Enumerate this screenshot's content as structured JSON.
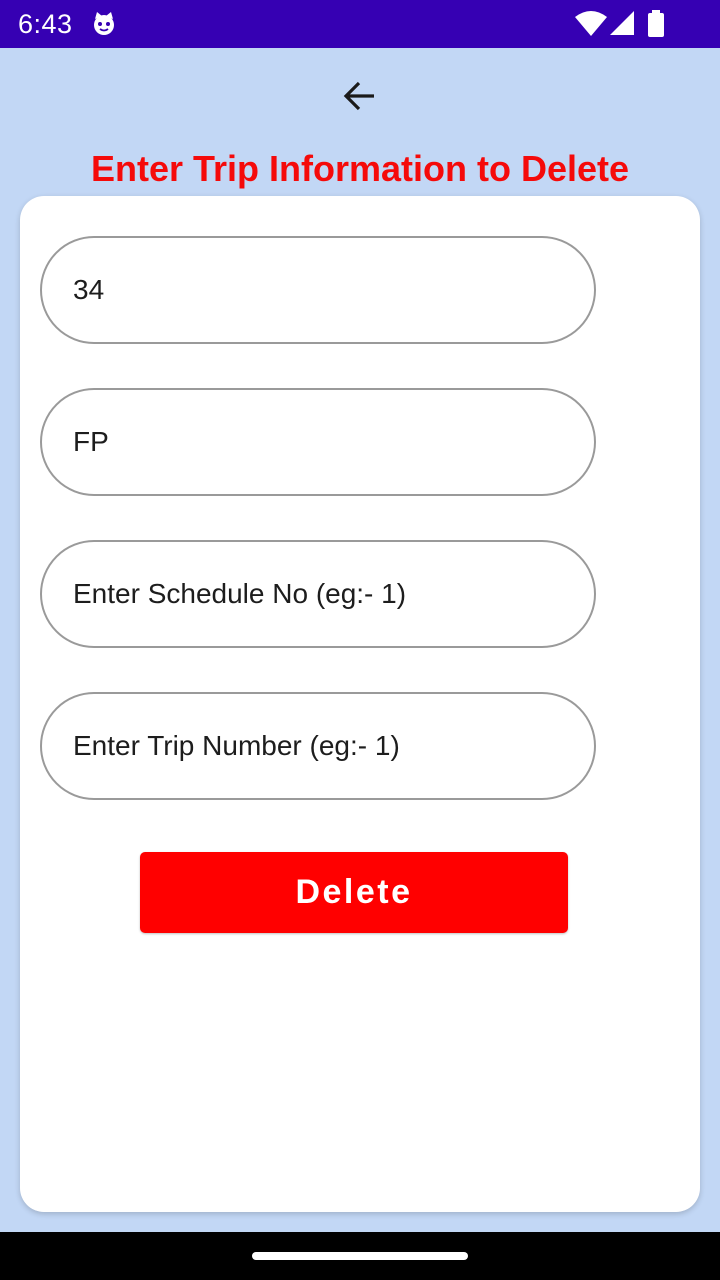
{
  "status_bar": {
    "time": "6:43",
    "icons": [
      "cat-notification-icon",
      "wifi-icon",
      "cellular-signal-icon",
      "battery-icon"
    ]
  },
  "header": {
    "back_icon": "arrow-left-icon",
    "title": "Enter Trip Information to Delete"
  },
  "form": {
    "fields": [
      {
        "value": "34",
        "placeholder": ""
      },
      {
        "value": "FP",
        "placeholder": ""
      },
      {
        "value": "",
        "placeholder": "Enter Schedule No (eg:- 1)"
      },
      {
        "value": "",
        "placeholder": "Enter Trip Number (eg:- 1)"
      }
    ],
    "delete_label": "Delete"
  },
  "colors": {
    "status_bar": "#3600b3",
    "background": "#c2d7f5",
    "title": "#f50a0a",
    "button": "#ff0000"
  }
}
